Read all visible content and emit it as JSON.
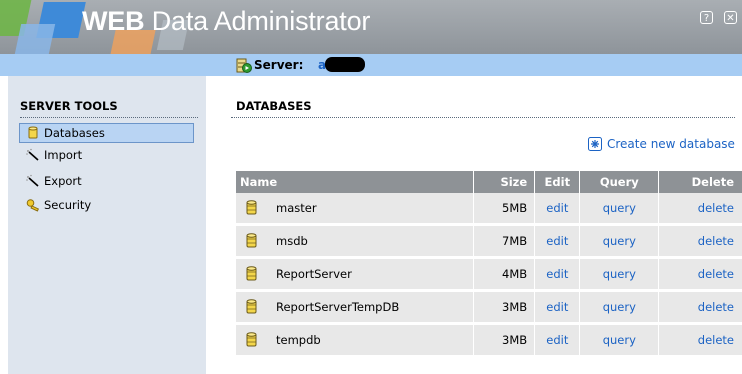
{
  "header": {
    "title_bold": "WEB",
    "title_rest": " Data Administrator",
    "help_icon": "help-icon",
    "close_icon": "close-icon"
  },
  "server": {
    "label": "Server:",
    "value": "a",
    "icon": "server-go-icon"
  },
  "sidebar": {
    "title": "SERVER TOOLS",
    "items": [
      {
        "label": "Databases",
        "icon": "database-icon",
        "selected": true
      },
      {
        "label": "Import",
        "icon": "wand-icon"
      },
      {
        "label": "Export",
        "icon": "wand-icon"
      },
      {
        "label": "Security",
        "icon": "key-icon"
      }
    ]
  },
  "main": {
    "title": "DATABASES",
    "create_link": "Create new database",
    "create_icon": "new-database-icon",
    "columns": [
      "Name",
      "Size",
      "Edit",
      "Query",
      "Delete"
    ],
    "rows": [
      {
        "name": "master",
        "size": "5MB",
        "edit": "edit",
        "query": "query",
        "delete": "delete"
      },
      {
        "name": "msdb",
        "size": "7MB",
        "edit": "edit",
        "query": "query",
        "delete": "delete"
      },
      {
        "name": "ReportServer",
        "size": "4MB",
        "edit": "edit",
        "query": "query",
        "delete": "delete"
      },
      {
        "name": "ReportServerTempDB",
        "size": "3MB",
        "edit": "edit",
        "query": "query",
        "delete": "delete"
      },
      {
        "name": "tempdb",
        "size": "3MB",
        "edit": "edit",
        "query": "query",
        "delete": "delete"
      }
    ]
  },
  "colors": {
    "header_bg": "#8e949a",
    "server_bar": "#a6ccf3",
    "sidebar_bg": "#dee5ee",
    "link": "#1c63c4",
    "table_header": "#8e9296",
    "row_bg": "#e8e8e8"
  }
}
